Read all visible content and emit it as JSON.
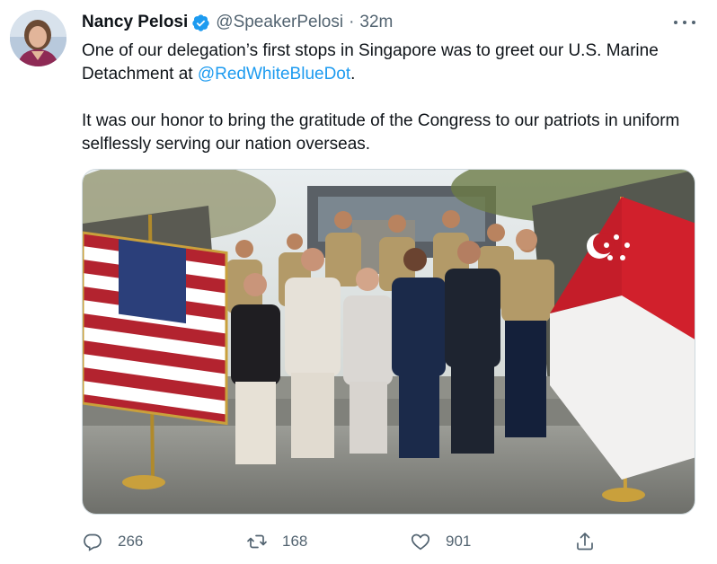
{
  "author": {
    "name": "Nancy Pelosi",
    "handle": "@SpeakerPelosi",
    "separator": "·",
    "time": "32m"
  },
  "tweet": {
    "para1_before": "One of our delegation’s first stops in Singapore was to greet our U.S. Marine Detachment at ",
    "mention": "@RedWhiteBlueDot",
    "para1_after": ".",
    "para2": "It was our honor to bring the gratitude of the Congress to our patriots in uniform selflessly serving our nation overseas."
  },
  "stats": {
    "replies": "266",
    "retweets": "168",
    "likes": "901"
  },
  "colors": {
    "accent": "#1d9bf0",
    "text": "#0f1419",
    "secondary": "#536471",
    "border": "#cfd9de"
  },
  "icons": [
    "verified-badge-icon",
    "more-options-icon",
    "reply-icon",
    "retweet-icon",
    "like-icon",
    "share-icon"
  ]
}
